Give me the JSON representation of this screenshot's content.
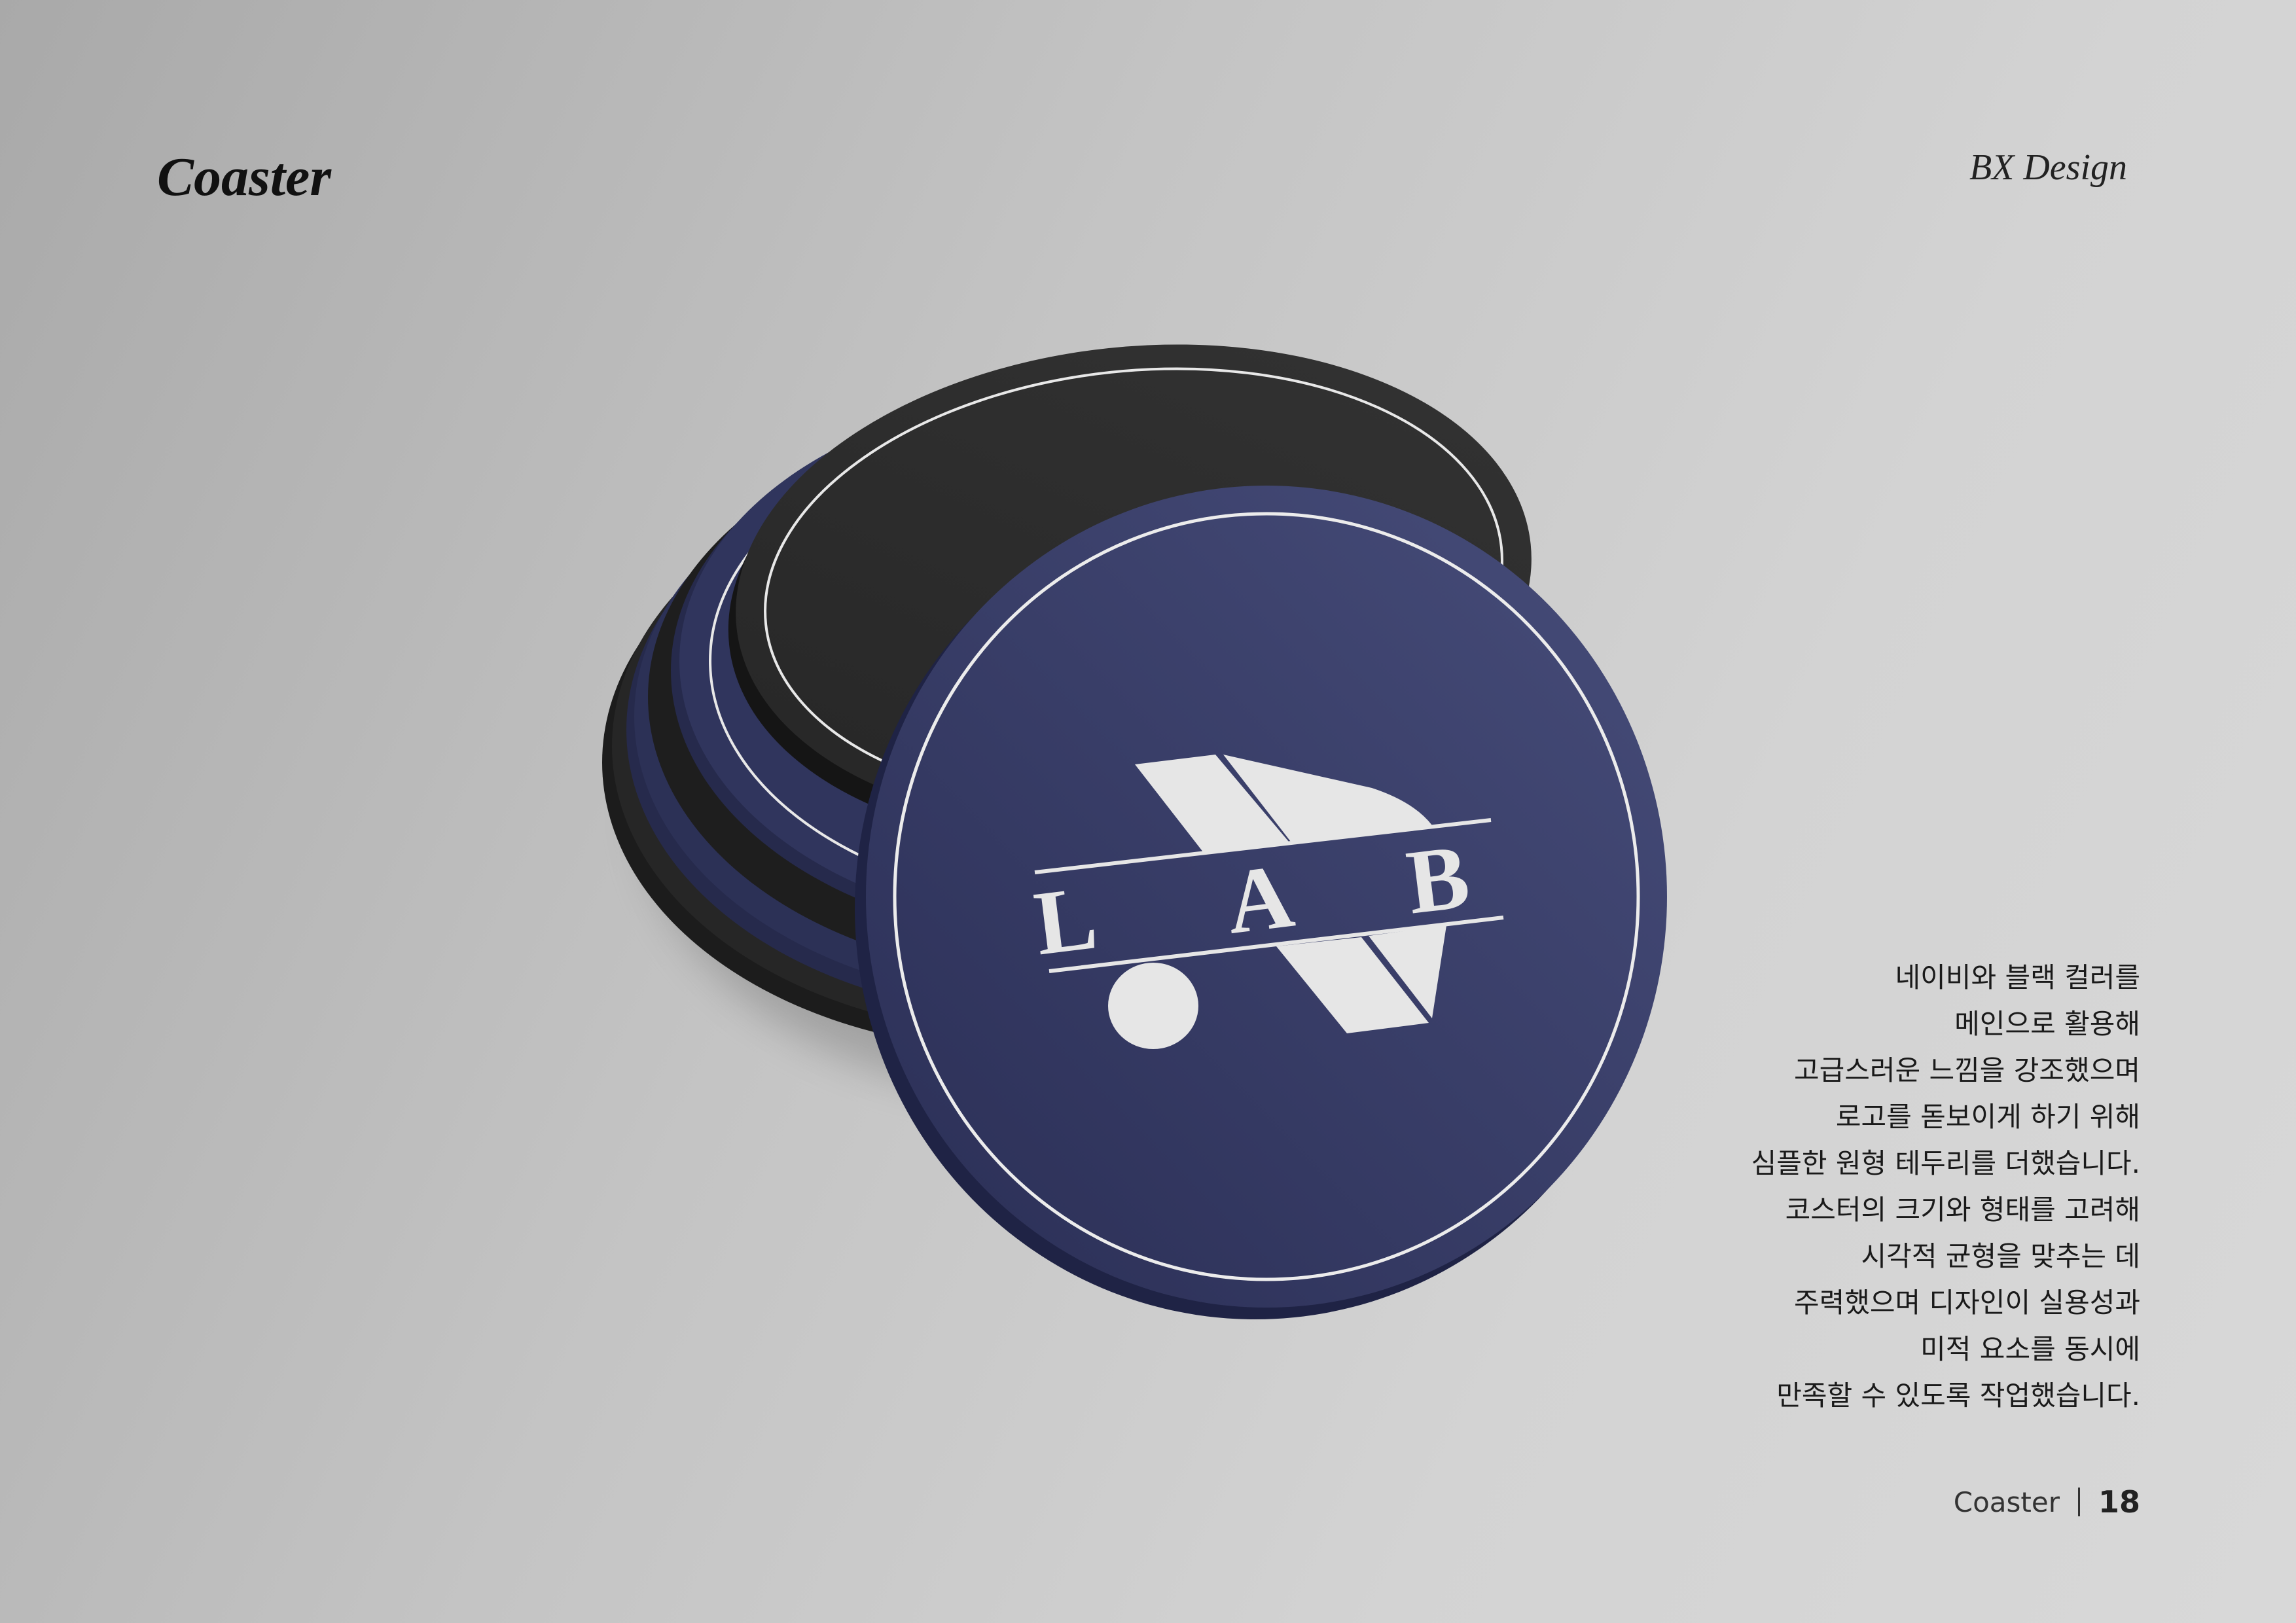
{
  "header": {
    "title": "Coaster",
    "brand": "BX Design"
  },
  "logo": {
    "letters": [
      "L",
      "A",
      "B"
    ]
  },
  "description": {
    "lines": [
      "네이비와 블랙 컬러를",
      "메인으로 활용해",
      "고급스러운 느낌을 강조했으며",
      "로고를 돋보이게 하기 위해",
      "심플한 원형 테두리를 더했습니다.",
      "코스터의 크기와 형태를 고려해",
      "시각적 균형을 맞추는 데",
      "주력했으며 디자인이 실용성과",
      "미적 요소를 동시에",
      "만족할 수 있도록 작업했습니다."
    ]
  },
  "footer": {
    "section": "Coaster",
    "page": "18"
  },
  "colors": {
    "navy": "#363b66",
    "black": "#2b2b2b",
    "logo": "#e6e6e6"
  }
}
